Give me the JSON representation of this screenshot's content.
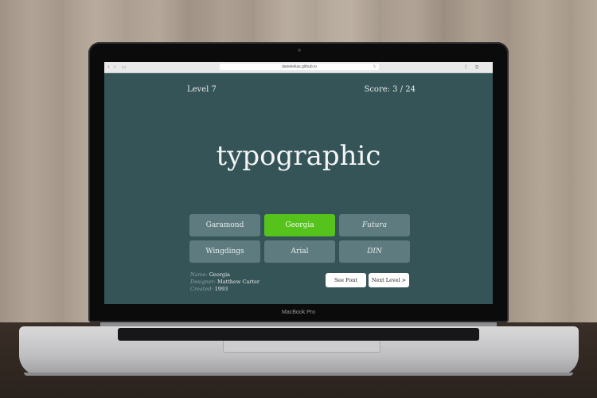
{
  "browser": {
    "url": "danielelias.github.io",
    "back_icon": "chevron-left-icon",
    "forward_icon": "chevron-right-icon",
    "sidebar_icon": "sidebar-icon",
    "share_icon": "share-icon",
    "tabs_icon": "tabs-icon",
    "reload_icon": "reload-icon"
  },
  "game": {
    "level": "Level 7",
    "score": "Score: 3 / 24",
    "word": "typographic",
    "options": [
      {
        "label": "Garamond",
        "selected": false
      },
      {
        "label": "Georgia",
        "selected": true
      },
      {
        "label": "Futura",
        "selected": false
      },
      {
        "label": "Wingdings",
        "selected": false
      },
      {
        "label": "Arial",
        "selected": false
      },
      {
        "label": "DIN",
        "selected": false
      }
    ],
    "details": {
      "name_label": "Name:",
      "name": "Georgia",
      "designer_label": "Designer:",
      "designer": "Matthew Carter",
      "created_label": "Created:",
      "created": "1993"
    },
    "see_font_label": "See Font",
    "next_level_label": "Next Level >"
  },
  "laptop": {
    "brand": "MacBook Pro"
  },
  "colors": {
    "screen_bg": "#355458",
    "selected": "#55c31b",
    "option_bg": "#5e7c80"
  }
}
